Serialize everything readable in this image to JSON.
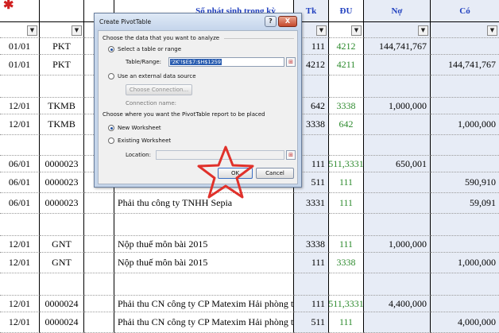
{
  "spreadsheet": {
    "header_title": "Số phát sinh trong kỳ",
    "header_tk": "Tk",
    "header_du": "ĐU",
    "header_no": "Nợ",
    "header_co": "Có",
    "dropdown_glyph": "▼",
    "rows": [
      {
        "date": "01/01",
        "doc": "PKT",
        "desc": "",
        "tk": "111",
        "du": "4212",
        "no": "144,741,767",
        "co": ""
      },
      {
        "date": "01/01",
        "doc": "PKT",
        "desc": "",
        "tk": "4212",
        "du": "4211",
        "no": "",
        "co": "144,741,767"
      },
      {
        "date": "",
        "doc": "",
        "desc": "",
        "tk": "",
        "du": "",
        "no": "",
        "co": ""
      },
      {
        "date": "12/01",
        "doc": "TKMB",
        "desc": "",
        "tk": "642",
        "du": "3338",
        "no": "1,000,000",
        "co": ""
      },
      {
        "date": "12/01",
        "doc": "TKMB",
        "desc": "",
        "tk": "3338",
        "du": "642",
        "no": "",
        "co": "1,000,000"
      },
      {
        "date": "",
        "doc": "",
        "desc": "",
        "tk": "",
        "du": "",
        "no": "",
        "co": ""
      },
      {
        "date": "06/01",
        "doc": "0000023",
        "desc": "",
        "tk": "111",
        "du": "511,3331",
        "no": "650,001",
        "co": ""
      },
      {
        "date": "06/01",
        "doc": "0000023",
        "desc": "",
        "tk": "511",
        "du": "111",
        "no": "",
        "co": "590,910"
      },
      {
        "date": "06/01",
        "doc": "0000023",
        "desc": "Phải thu công ty TNHH Sepia",
        "tk": "3331",
        "du": "111",
        "no": "",
        "co": "59,091"
      },
      {
        "date": "",
        "doc": "",
        "desc": "",
        "tk": "",
        "du": "",
        "no": "",
        "co": ""
      },
      {
        "date": "12/01",
        "doc": "GNT",
        "desc": "Nộp thuế môn bài 2015",
        "tk": "3338",
        "du": "111",
        "no": "1,000,000",
        "co": ""
      },
      {
        "date": "12/01",
        "doc": "GNT",
        "desc": "Nộp thuế môn bài 2015",
        "tk": "111",
        "du": "3338",
        "no": "",
        "co": "1,000,000"
      },
      {
        "date": "",
        "doc": "",
        "desc": "",
        "tk": "",
        "du": "",
        "no": "",
        "co": ""
      },
      {
        "date": "12/01",
        "doc": "0000024",
        "desc": "Phải thu CN công ty CP Matexim Hải phòng tại Hà Nội",
        "tk": "111",
        "du": "511,3331",
        "no": "4,400,000",
        "co": ""
      },
      {
        "date": "12/01",
        "doc": "0000024",
        "desc": "Phải thu CN công ty CP Matexim Hải phòng tại Hà Nội",
        "tk": "511",
        "du": "111",
        "no": "",
        "co": "4,000,000"
      }
    ]
  },
  "dialog": {
    "title": "Create PivotTable",
    "help_label": "?",
    "close_label": "X",
    "section_choose_data": "Choose the data that you want to analyze",
    "option_select_table": "Select a table or range",
    "table_range_label": "Table/Range:",
    "table_range_value": "'2K'!$E$7:$H$1259",
    "option_external": "Use an external data source",
    "choose_connection_label": "Choose Connection...",
    "connection_name_label": "Connection name:",
    "section_place": "Choose where you want the PivotTable report to be placed",
    "option_new_ws": "New Worksheet",
    "option_existing_ws": "Existing Worksheet",
    "location_label": "Location:",
    "location_value": "",
    "ok_label": "OK",
    "cancel_label": "Cancel",
    "picker_glyph": "⊞"
  },
  "colors": {
    "star": "#e0312b",
    "accent_blue_header": "#1f3fbf",
    "green_values": "#2e8b2e",
    "dialog_frame": "#c5d5ea"
  }
}
